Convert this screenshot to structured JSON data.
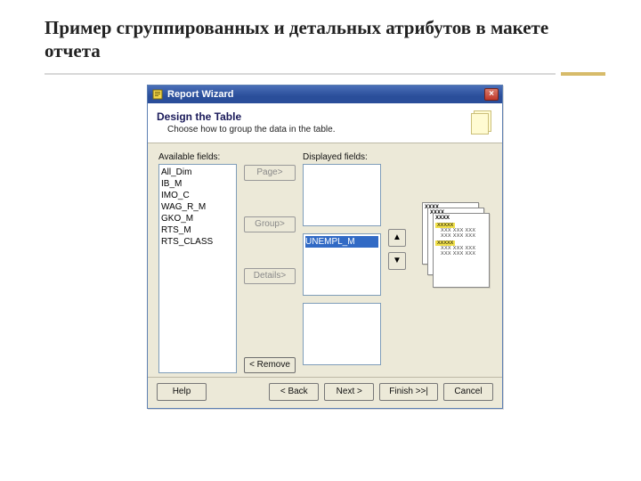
{
  "slide": {
    "title": "Пример сгруппированных и детальных атрибутов в макете отчета"
  },
  "window": {
    "title": "Report Wizard",
    "header": {
      "title": "Design the Table",
      "subtitle": "Choose how to group the data in the table."
    },
    "labels": {
      "available": "Available fields:",
      "displayed": "Displayed fields:"
    },
    "available_fields": [
      "All_Dim",
      "IB_M",
      "IMO_C",
      "WAG_R_M",
      "GKO_M",
      "RTS_M",
      "RTS_CLASS"
    ],
    "displayed": {
      "page": [],
      "group": [
        "UNEMPL_M"
      ],
      "details": []
    },
    "buttons": {
      "page": "Page>",
      "group": "Group>",
      "details": "Details>",
      "remove": "< Remove",
      "up": "▲",
      "down": "▼",
      "help": "Help",
      "back": "< Back",
      "next": "Next >",
      "finish": "Finish >>|",
      "cancel": "Cancel"
    },
    "preview": {
      "hdr": "XXXX",
      "hl": "XXXXX",
      "line": "XXX XXX XXX"
    }
  }
}
